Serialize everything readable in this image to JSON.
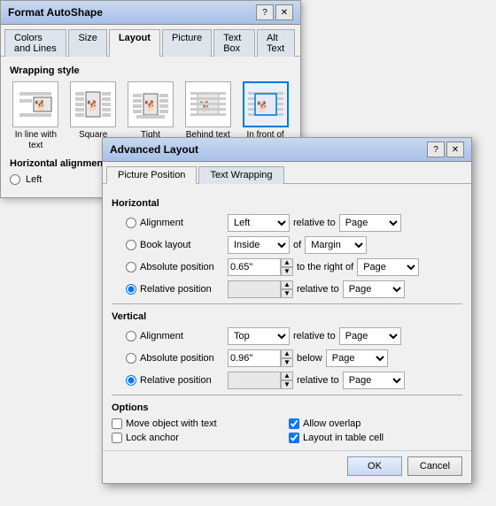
{
  "outer_dialog": {
    "title": "Format AutoShape",
    "title_buttons": [
      "?",
      "✕"
    ],
    "tabs": [
      {
        "label": "Colors and Lines",
        "active": false
      },
      {
        "label": "Size",
        "active": false
      },
      {
        "label": "Layout",
        "active": true
      },
      {
        "label": "Picture",
        "active": false
      },
      {
        "label": "Text Box",
        "active": false
      },
      {
        "label": "Alt Text",
        "active": false
      }
    ],
    "wrapping_style_label": "Wrapping style",
    "wrap_options": [
      {
        "label": "In line with text",
        "selected": false
      },
      {
        "label": "Square",
        "selected": false
      },
      {
        "label": "Tight",
        "selected": false
      },
      {
        "label": "Behind text",
        "selected": false
      },
      {
        "label": "In front of text",
        "selected": true
      }
    ],
    "horizontal_alignment_label": "Horizontal alignment",
    "radio_left_label": "Left"
  },
  "advanced_dialog": {
    "title": "Advanced Layout",
    "title_buttons": [
      "?",
      "✕"
    ],
    "tabs": [
      {
        "label": "Picture Position",
        "active": true
      },
      {
        "label": "Text Wrapping",
        "active": false
      }
    ],
    "horizontal_label": "Horizontal",
    "h_fields": [
      {
        "radio_label": "Alignment",
        "dropdown1_value": "Left",
        "between_label": "relative to",
        "dropdown2_value": "Page"
      },
      {
        "radio_label": "Book layout",
        "dropdown1_value": "Inside",
        "between_label": "of",
        "dropdown2_value": "Margin"
      },
      {
        "radio_label": "Absolute position",
        "spin_value": "0.65\"",
        "between_label": "to the right of",
        "dropdown2_value": "Page"
      },
      {
        "radio_label": "Relative position",
        "spin_value": "",
        "between_label": "relative to",
        "dropdown2_value": "Page",
        "selected": true
      }
    ],
    "vertical_label": "Vertical",
    "v_fields": [
      {
        "radio_label": "Alignment",
        "dropdown1_value": "Top",
        "between_label": "relative to",
        "dropdown2_value": "Page"
      },
      {
        "radio_label": "Absolute position",
        "spin_value": "0.96\"",
        "between_label": "below",
        "dropdown2_value": "Page"
      },
      {
        "radio_label": "Relative position",
        "spin_value": "",
        "between_label": "relative to",
        "dropdown2_value": "Page",
        "selected": true
      }
    ],
    "options_label": "Options",
    "checkboxes_left": [
      {
        "label": "Move object with text",
        "checked": false
      },
      {
        "label": "Lock anchor",
        "checked": false
      }
    ],
    "checkboxes_right": [
      {
        "label": "Allow overlap",
        "checked": true
      },
      {
        "label": "Layout in table cell",
        "checked": true
      }
    ],
    "ok_label": "OK",
    "cancel_label": "Cancel"
  }
}
